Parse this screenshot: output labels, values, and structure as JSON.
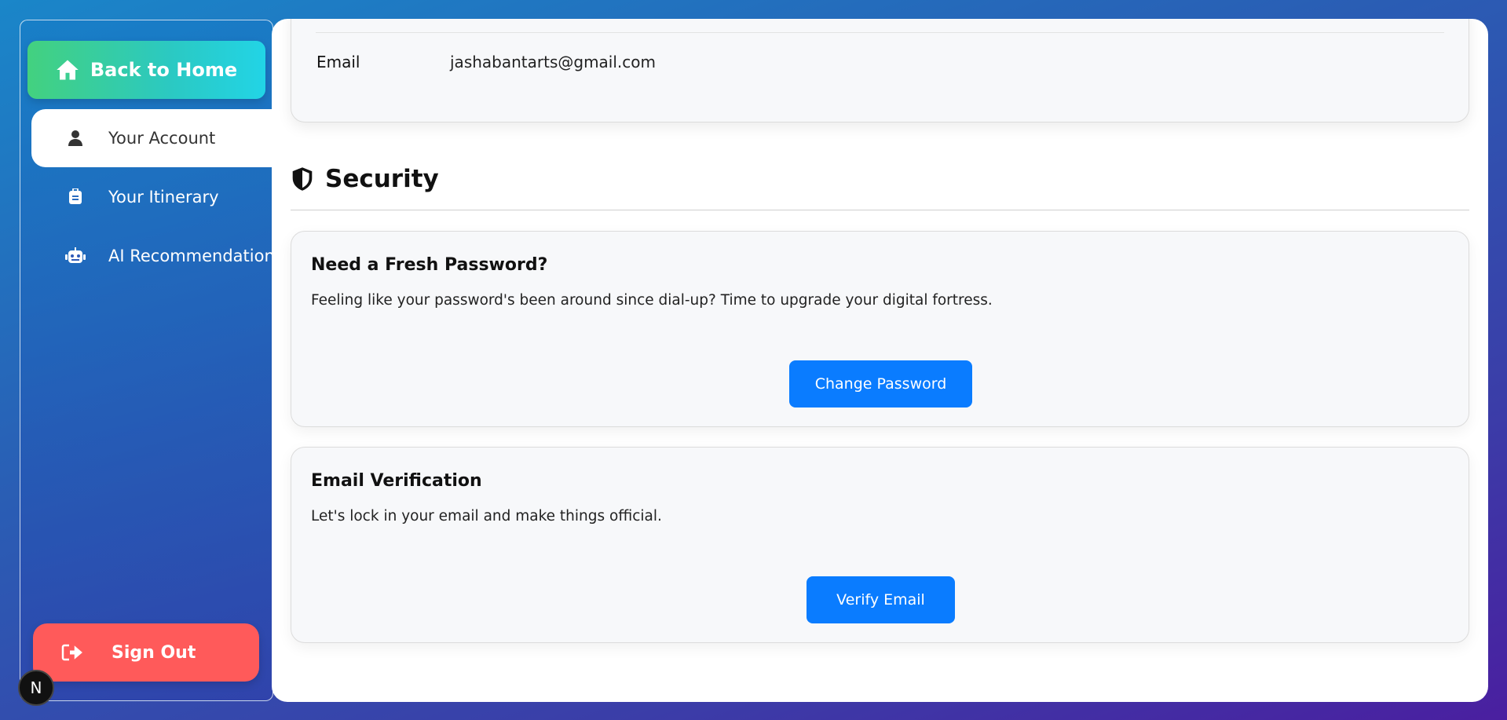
{
  "sidebar": {
    "home_label": "Back to Home",
    "items": [
      {
        "label": "Your Account",
        "icon": "user-icon",
        "active": true
      },
      {
        "label": "Your Itinerary",
        "icon": "suitcase-icon",
        "active": false
      },
      {
        "label": "AI Recommendations",
        "icon": "robot-icon",
        "active": false
      }
    ],
    "signout_label": "Sign Out",
    "badge_label": "N"
  },
  "account": {
    "email_label": "Email",
    "email_value": "jashabantarts@gmail.com"
  },
  "security": {
    "title": "Security",
    "password_card": {
      "title": "Need a Fresh Password?",
      "text": "Feeling like your password's been around since dial-up? Time to upgrade your digital fortress.",
      "button_label": "Change Password"
    },
    "verify_card": {
      "title": "Email Verification",
      "text": "Let's lock in your email and make things official.",
      "button_label": "Verify Email"
    }
  },
  "colors": {
    "accent_blue": "#0a7cff",
    "signout_red": "#ff5a5a",
    "home_gradient_start": "#43d17f",
    "home_gradient_end": "#22d4e6"
  }
}
